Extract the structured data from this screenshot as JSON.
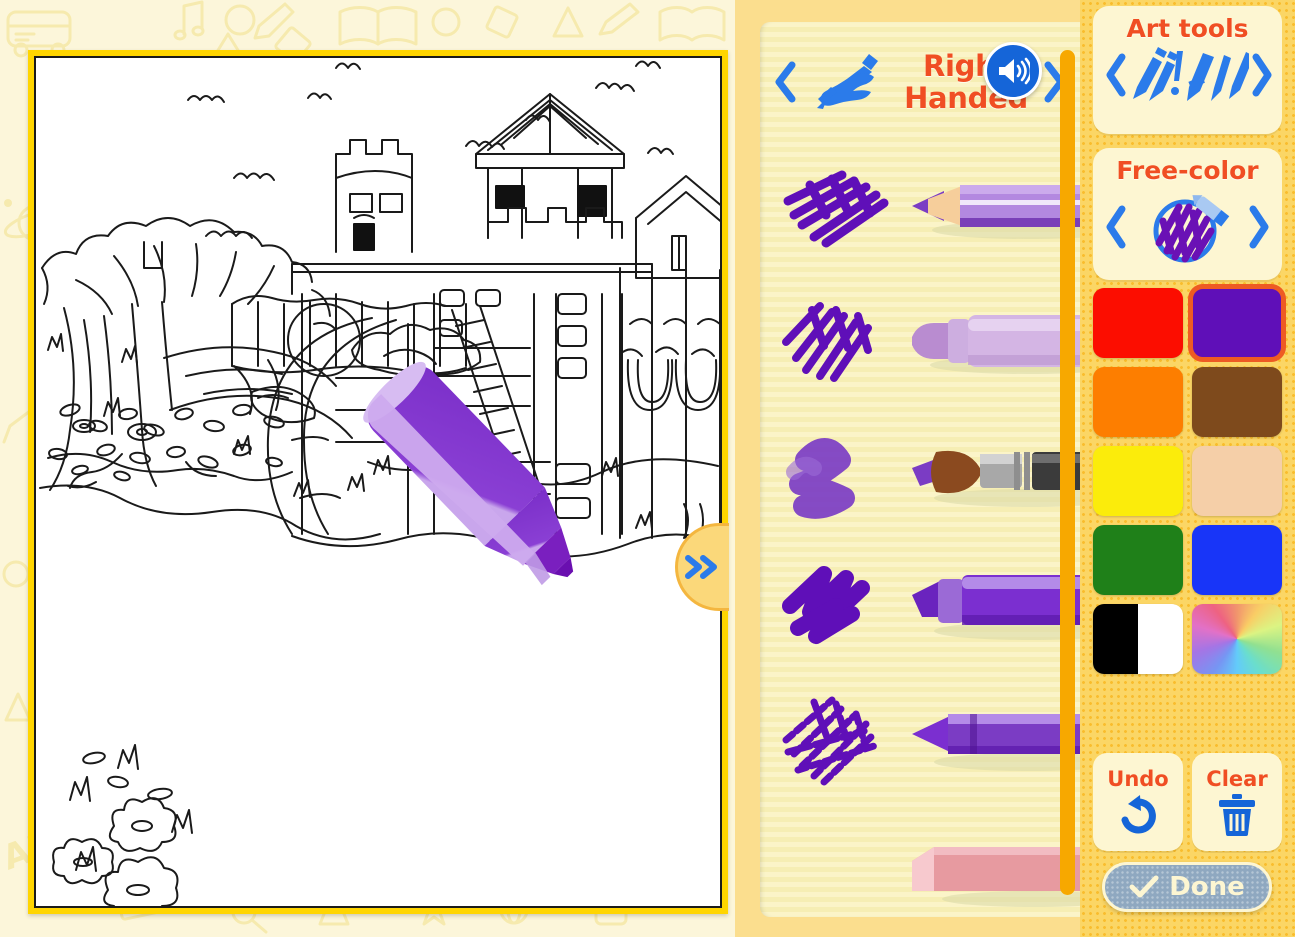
{
  "app": {
    "background_color": "#FCF6DA",
    "accent_orange": "#F04E23",
    "accent_blue": "#1565D8",
    "panel_cream": "#FDF6D2",
    "sidebar_yellow": "#FBD665"
  },
  "canvas": {
    "name": "coloring-canvas",
    "artwork_title": "Playground with castle and tree",
    "frame_color": "#FFD500",
    "paper_color": "#FFFFFF",
    "cursor_tool": "marker",
    "cursor_color": "#7B3CC4",
    "expand_tab_icon": "double-chevron-right-icon"
  },
  "background_doodles": [
    "school-bus-doodle",
    "circle-doodle",
    "diamond-doodle",
    "triangle-doodle",
    "planet-doodle",
    "music-note-doodle",
    "pencil-doodle",
    "book-doodle",
    "abc-doodle",
    "ruler-doodle",
    "paint-palette-doodle",
    "star-doodle",
    "backpack-doodle",
    "flask-doodle",
    "apple-doodle",
    "globe-doodle"
  ],
  "tool_drawer": {
    "name": "art-tool-drawer",
    "header": {
      "prev_icon": "chevron-left-icon",
      "handedness_icon": "writing-hand-icon",
      "label": "Right Handed",
      "next_icon": "chevron-right-icon",
      "speaker_icon": "speaker-on-icon"
    },
    "scrollbar": {
      "name": "drawer-scrollbar",
      "color": "#F7A800"
    },
    "tools": [
      {
        "id": "colored-pencil",
        "label": "Colored pencil",
        "stroke_style": "hatched-lines",
        "body_color": "#B388E0",
        "selected": false
      },
      {
        "id": "felt-marker",
        "label": "Felt marker",
        "stroke_style": "scribble-lines",
        "body_color": "#D7B8E8",
        "selected": false
      },
      {
        "id": "paint-brush",
        "label": "Paint brush",
        "stroke_style": "soft-blob",
        "body_color": "#8B4A1F",
        "selected": false
      },
      {
        "id": "highlighter",
        "label": "Highlighter",
        "stroke_style": "thick-scribble",
        "body_color": "#7B2FD0",
        "selected": true
      },
      {
        "id": "crayon",
        "label": "Crayon",
        "stroke_style": "rough-texture",
        "body_color": "#7B3CC4",
        "selected": false
      },
      {
        "id": "eraser",
        "label": "Eraser",
        "stroke_style": "none",
        "body_color": "#E79AA0",
        "selected": false
      }
    ]
  },
  "sidebar": {
    "art_tools": {
      "title": "Art tools",
      "prev_icon": "chevron-left-icon",
      "icon": "art-tools-icon",
      "next_icon": "chevron-right-icon"
    },
    "free_color": {
      "title": "Free-color",
      "prev_icon": "chevron-left-icon",
      "icon": "free-color-scribble-icon",
      "next_icon": "chevron-right-icon"
    },
    "palette": {
      "name": "color-palette",
      "selected_index": 1,
      "colors": [
        {
          "name": "red",
          "hex": "#FC0D00"
        },
        {
          "name": "purple",
          "hex": "#5F0FB8"
        },
        {
          "name": "orange",
          "hex": "#FD7E00"
        },
        {
          "name": "brown",
          "hex": "#7E4A1C"
        },
        {
          "name": "yellow",
          "hex": "#FBEC0B"
        },
        {
          "name": "skin-peach",
          "hex": "#F5CFA8"
        },
        {
          "name": "green",
          "hex": "#1F8019"
        },
        {
          "name": "blue",
          "hex": "#1835F8"
        },
        {
          "name": "black-white",
          "hex": "#000000"
        },
        {
          "name": "rainbow",
          "hex": "#FF6FA8"
        }
      ]
    },
    "actions": {
      "undo": {
        "label": "Undo",
        "icon": "undo-arrow-icon"
      },
      "clear": {
        "label": "Clear",
        "icon": "trash-can-icon"
      },
      "done": {
        "label": "Done",
        "icon": "check-mark-icon"
      }
    }
  }
}
